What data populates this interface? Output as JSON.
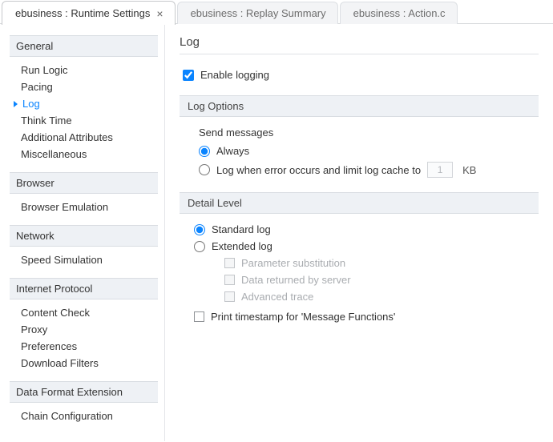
{
  "tabs": [
    {
      "label": "ebusiness : Runtime Settings",
      "active": true,
      "closable": true
    },
    {
      "label": "ebusiness : Replay Summary",
      "active": false,
      "closable": false
    },
    {
      "label": "ebusiness : Action.c",
      "active": false,
      "closable": false
    }
  ],
  "sidebar": {
    "sections": [
      {
        "title": "General",
        "items": [
          {
            "label": "Run Logic"
          },
          {
            "label": "Pacing"
          },
          {
            "label": "Log",
            "active": true
          },
          {
            "label": "Think Time"
          },
          {
            "label": "Additional Attributes"
          },
          {
            "label": "Miscellaneous"
          }
        ]
      },
      {
        "title": "Browser",
        "items": [
          {
            "label": "Browser Emulation"
          }
        ]
      },
      {
        "title": "Network",
        "items": [
          {
            "label": "Speed Simulation"
          }
        ]
      },
      {
        "title": "Internet Protocol",
        "items": [
          {
            "label": "Content Check"
          },
          {
            "label": "Proxy"
          },
          {
            "label": "Preferences"
          },
          {
            "label": "Download Filters"
          }
        ]
      },
      {
        "title": "Data Format Extension",
        "items": [
          {
            "label": "Chain Configuration"
          }
        ]
      }
    ]
  },
  "page": {
    "title": "Log",
    "enable_label": "Enable logging",
    "enable_checked": true,
    "log_options_title": "Log Options",
    "send_messages_label": "Send messages",
    "send_always": "Always",
    "send_on_error": "Log when error occurs and limit log cache to",
    "cache_value": "1",
    "cache_unit": "KB",
    "detail_title": "Detail Level",
    "standard_log": "Standard log",
    "extended_log": "Extended log",
    "ext_param": "Parameter substitution",
    "ext_data": "Data returned by server",
    "ext_trace": "Advanced trace",
    "print_ts": "Print timestamp for 'Message Functions'"
  }
}
